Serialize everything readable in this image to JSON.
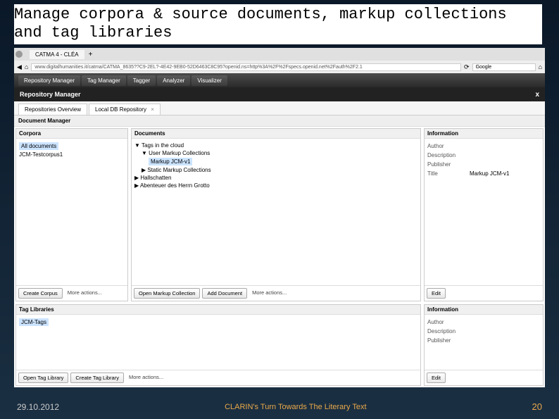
{
  "slide": {
    "title": "Manage corpora & source documents, markup collections and tag libraries",
    "date": "29.10.2012",
    "center_footer": "CLARIN's Turn Towards The Literary Text",
    "page_number": "20"
  },
  "browser": {
    "tab_label": "CATMA 4 - CLÉA",
    "plus": "+",
    "url": "www.digitalhumanities.it/catma/CATMA_8635??C9-2EL?-4E42-9EB0-52D6463C8C95?openid.ns=http%3A%2F%2Fspecs.openid.net%2Fauth%2F2.1",
    "search_placeholder": "Google"
  },
  "navbar": {
    "items": [
      "Repository Manager",
      "Tag Manager",
      "Tagger",
      "Analyzer",
      "Visualizer"
    ]
  },
  "panel": {
    "title": "Repository Manager",
    "close": "x"
  },
  "inner_tabs": {
    "items": [
      "Repositories Overview",
      "Local DB Repository"
    ]
  },
  "document_manager_label": "Document Manager",
  "corpora": {
    "header": "Corpora",
    "items": [
      "All documents",
      "JCM-Testcorpus1"
    ],
    "create_btn": "Create Corpus",
    "more_btn": "More actions..."
  },
  "documents": {
    "header": "Documents",
    "root": "Tags in the cloud",
    "user_collections_label": "User Markup Collections",
    "selected_collection": "Markup JCM-v1",
    "static_collections_label": "Static Markup Collections",
    "doc2": "Hallschatten",
    "doc3": "Abenteuer des Herrn Grotto",
    "open_btn": "Open Markup Collection",
    "add_btn": "Add Document",
    "more_btn": "More actions..."
  },
  "info": {
    "header": "Information",
    "fields": {
      "author_label": "Author",
      "author_val": "",
      "description_label": "Description",
      "description_val": "",
      "publisher_label": "Publisher",
      "publisher_val": "",
      "title_label": "Title",
      "title_val": "Markup JCM-v1"
    },
    "edit_btn": "Edit"
  },
  "tag_libs": {
    "header": "Tag Libraries",
    "items": [
      "JCM-Tags"
    ],
    "open_btn": "Open Tag Library",
    "create_btn": "Create Tag Library",
    "more_btn": "More actions..."
  },
  "info2": {
    "header": "Information",
    "author_label": "Author",
    "description_label": "Description",
    "publisher_label": "Publisher",
    "edit_btn": "Edit"
  }
}
